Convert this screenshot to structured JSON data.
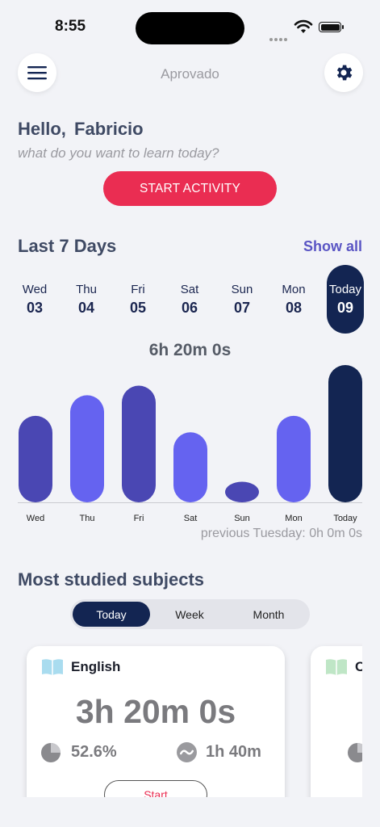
{
  "status_bar": {
    "time": "8:55"
  },
  "header": {
    "title": "Aprovado",
    "menu_icon": "hamburger-menu-icon",
    "settings_icon": "gear-icon"
  },
  "greeting": {
    "hello": "Hello,",
    "name": "Fabricio",
    "subtitle": "what do you want to learn today?",
    "start_label": "START ACTIVITY"
  },
  "last7": {
    "title": "Last 7 Days",
    "show_all": "Show all",
    "days": [
      {
        "name": "Wed",
        "date": "03"
      },
      {
        "name": "Thu",
        "date": "04"
      },
      {
        "name": "Fri",
        "date": "05"
      },
      {
        "name": "Sat",
        "date": "06"
      },
      {
        "name": "Sun",
        "date": "07"
      },
      {
        "name": "Mon",
        "date": "08"
      },
      {
        "name": "Today",
        "date": "09",
        "active": true
      }
    ],
    "total_time": "6h 20m 0s",
    "previous": "previous Tuesday: 0h 0m 0s"
  },
  "chart_data": {
    "type": "bar",
    "categories": [
      "Wed",
      "Thu",
      "Fri",
      "Sat",
      "Sun",
      "Mon",
      "Today"
    ],
    "values": [
      0.63,
      0.78,
      0.85,
      0.51,
      0.15,
      0.63,
      1.0
    ],
    "colors": [
      "#4a47b3",
      "#6563f0",
      "#4a47b3",
      "#6563f0",
      "#4a47b3",
      "#6563f0",
      "#132552"
    ]
  },
  "subjects": {
    "title": "Most studied subjects",
    "tabs": [
      {
        "label": "Today",
        "active": true
      },
      {
        "label": "Week"
      },
      {
        "label": "Month"
      }
    ],
    "cards": [
      {
        "name": "English",
        "time": "3h 20m 0s",
        "percent": "52.6%",
        "average": "1h 40m",
        "start_label": "Start",
        "icon_color": "#a9dcef"
      },
      {
        "name": "C",
        "icon_color": "#bfe6c6"
      }
    ]
  },
  "colors": {
    "accent_red": "#ea2d52",
    "navy": "#132552",
    "link": "#5a55c4"
  }
}
